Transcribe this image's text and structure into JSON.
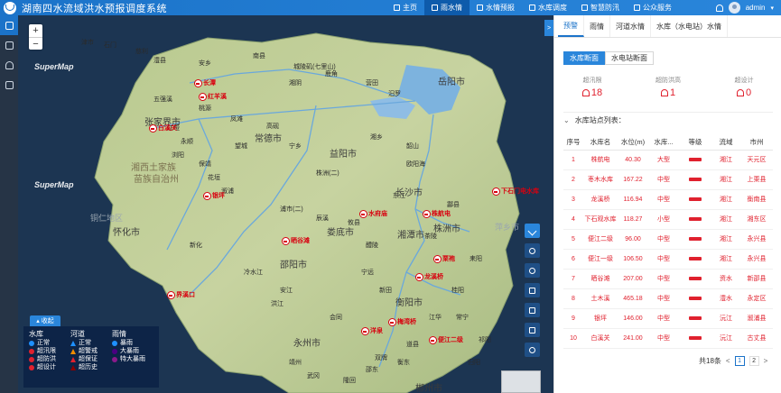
{
  "header": {
    "title": "湖南四水流域洪水预报调度系统",
    "nav": [
      {
        "label": "主页",
        "icon": "home-icon",
        "active": false
      },
      {
        "label": "雨水情",
        "icon": "rain-icon",
        "active": true
      },
      {
        "label": "水情预报",
        "icon": "forecast-icon",
        "active": false
      },
      {
        "label": "水库调度",
        "icon": "reservoir-icon",
        "active": false
      },
      {
        "label": "智慧防汛",
        "icon": "flood-icon",
        "active": false
      },
      {
        "label": "公众服务",
        "icon": "public-icon",
        "active": false
      }
    ],
    "user": "admin"
  },
  "leftbar": [
    "layers-icon",
    "document-icon",
    "cloud-icon",
    "grid-icon"
  ],
  "map": {
    "zoom_in": "+",
    "zoom_out": "−",
    "watermark": "SuperMap",
    "toggle": ">",
    "cities": [
      {
        "name": "岳阳市",
        "big": true
      },
      {
        "name": "常德市",
        "big": true
      },
      {
        "name": "张家界市",
        "big": true
      },
      {
        "name": "湘西土家族",
        "big": false,
        "region": true
      },
      {
        "name": "苗族自治州",
        "big": false,
        "region": true
      },
      {
        "name": "怀化市",
        "big": true
      },
      {
        "name": "益阳市",
        "big": true
      },
      {
        "name": "长沙市",
        "big": true
      },
      {
        "name": "娄底市",
        "big": true
      },
      {
        "name": "湘潭市",
        "big": true
      },
      {
        "name": "株洲市",
        "big": true
      },
      {
        "name": "邵阳市",
        "big": true
      },
      {
        "name": "衡阳市",
        "big": true
      },
      {
        "name": "永州市",
        "big": true
      },
      {
        "name": "郴州市",
        "big": true
      },
      {
        "name": "萍乡市",
        "big": false,
        "outer": true
      },
      {
        "name": "铜仁地区",
        "big": false,
        "outer": true
      }
    ],
    "small_places": [
      "津市",
      "石门",
      "慈利",
      "澧县",
      "安乡",
      "南县",
      "城陵矶(七里山)",
      "鹿角",
      "营田",
      "汨罗",
      "湘阴",
      "桃源",
      "五强溪",
      "江垭",
      "永顺",
      "凤滩",
      "高砚",
      "保靖",
      "花垣",
      "溆浦",
      "浦市(二)",
      "辰溪",
      "新化",
      "冷水江",
      "安江",
      "洪江",
      "会同",
      "靖州",
      "武冈",
      "隆回",
      "邵东",
      "双牌",
      "道县",
      "江华",
      "宁远",
      "新田",
      "桂阳",
      "耒阳",
      "常宁",
      "祁阳",
      "归阳",
      "衡东",
      "攸县",
      "醴陵",
      "茶陵",
      "酃县",
      "东江",
      "欧阳海",
      "韶山",
      "湘乡",
      "株洲(二)",
      "浏阳",
      "望城",
      "宁乡"
    ],
    "stations": [
      {
        "name": "长潭"
      },
      {
        "name": "白溪关"
      },
      {
        "name": "红羊溪"
      },
      {
        "name": "银坪"
      },
      {
        "name": "晒谷滩"
      },
      {
        "name": "界溪口"
      },
      {
        "name": "水府庙"
      },
      {
        "name": "株航电"
      },
      {
        "name": "下石门电水库"
      },
      {
        "name": "龙溪桥"
      },
      {
        "name": "梅湾桥"
      },
      {
        "name": "洋泉"
      },
      {
        "name": "便江二级"
      },
      {
        "name": "栗袍"
      }
    ],
    "legend": {
      "collapse_label": "收起",
      "columns": [
        {
          "title": "水库",
          "items": [
            {
              "label": "正常",
              "color": "#1e90ff"
            },
            {
              "label": "超汛限",
              "color": "#e0212e"
            },
            {
              "label": "超防洪",
              "color": "#e0212e"
            },
            {
              "label": "超设计",
              "color": "#e0212e"
            }
          ]
        },
        {
          "title": "河道",
          "items": [
            {
              "label": "正常",
              "color": "#1e90ff"
            },
            {
              "label": "超警戒",
              "color": "#f08c00"
            },
            {
              "label": "超保证",
              "color": "#e0212e"
            },
            {
              "label": "超历史",
              "color": "#8b0000"
            }
          ]
        },
        {
          "title": "雨情",
          "items": [
            {
              "label": "暴雨",
              "color": "#1e90ff"
            },
            {
              "label": "大暴雨",
              "color": "#4b0082"
            },
            {
              "label": "特大暴雨",
              "color": "#8b1a8b"
            }
          ]
        }
      ]
    },
    "tools": [
      "expand-icon",
      "search-icon",
      "layer-icon",
      "measure-icon",
      "draw-icon",
      "delete-icon",
      "locate-icon"
    ]
  },
  "panel": {
    "tabs": [
      {
        "label": "预警",
        "active": true
      },
      {
        "label": "雨情",
        "active": false
      },
      {
        "label": "河道水情",
        "active": false
      },
      {
        "label": "水库（水电站）水情",
        "active": false
      }
    ],
    "subtabs": [
      {
        "label": "水库断面",
        "active": true
      },
      {
        "label": "水电站断面",
        "active": false
      }
    ],
    "stats": [
      {
        "label": "超汛限",
        "value": "18"
      },
      {
        "label": "超防洪高",
        "value": "1"
      },
      {
        "label": "超设计",
        "value": "0"
      }
    ],
    "list_title": "水库站点列表：",
    "columns": [
      "序号",
      "水库名",
      "水位(m)",
      "水库...",
      "等级",
      "流域",
      "市州"
    ],
    "rows": [
      {
        "no": "1",
        "name": "株航电",
        "level": "40.30",
        "type": "大型",
        "basin": "湘江",
        "city": "天元区"
      },
      {
        "no": "2",
        "name": "枣木水库",
        "level": "167.22",
        "type": "中型",
        "basin": "湘江",
        "city": "上栗县"
      },
      {
        "no": "3",
        "name": "龙溪桥",
        "level": "116.94",
        "type": "中型",
        "basin": "湘江",
        "city": "衡南县"
      },
      {
        "no": "4",
        "name": "下石观水库",
        "level": "118.27",
        "type": "小型",
        "basin": "湘江",
        "city": "湘东区"
      },
      {
        "no": "5",
        "name": "便江二级",
        "level": "96.00",
        "type": "中型",
        "basin": "湘江",
        "city": "永兴县"
      },
      {
        "no": "6",
        "name": "便江一级",
        "level": "106.50",
        "type": "中型",
        "basin": "湘江",
        "city": "永兴县"
      },
      {
        "no": "7",
        "name": "晒谷滩",
        "level": "207.00",
        "type": "中型",
        "basin": "资水",
        "city": "新邵县"
      },
      {
        "no": "8",
        "name": "土木溪",
        "level": "465.18",
        "type": "中型",
        "basin": "澧水",
        "city": "永定区"
      },
      {
        "no": "9",
        "name": "银坪",
        "level": "146.00",
        "type": "中型",
        "basin": "沅江",
        "city": "溆浦县"
      },
      {
        "no": "10",
        "name": "白溪关",
        "level": "241.00",
        "type": "中型",
        "basin": "沅江",
        "city": "古丈县"
      }
    ],
    "pager": {
      "total": "共18条",
      "prev": "<",
      "pages": [
        "1",
        "2"
      ],
      "next": ">"
    }
  }
}
